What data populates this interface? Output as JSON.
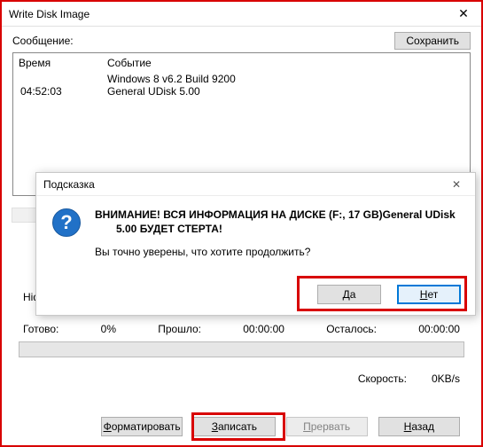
{
  "window": {
    "title": "Write Disk Image",
    "close_glyph": "✕"
  },
  "message": {
    "label": "Сообщение:",
    "save_label": "Сохранить"
  },
  "log": {
    "col_time": "Время",
    "col_event": "Событие",
    "rows": [
      {
        "time": "",
        "event": "Windows 8 v6.2 Build 9200"
      },
      {
        "time": "04:52:03",
        "event": "General UDisk        5.00"
      }
    ]
  },
  "hidden_label_prefix": "Hid",
  "progress": {
    "ready_label": "Готово:",
    "percent": "0%",
    "elapsed_label": "Прошло:",
    "elapsed": "00:00:00",
    "remain_label": "Осталось:",
    "remain": "00:00:00"
  },
  "speed": {
    "label": "Скорость:",
    "value": "0KB/s"
  },
  "buttons": {
    "format": "Форматировать",
    "write": "Записать",
    "abort": "Прервать",
    "back": "Назад",
    "format_u": "Ф",
    "write_u": "З",
    "abort_u": "П",
    "back_u": "Н"
  },
  "dialog": {
    "title": "Подсказка",
    "close_glyph": "✕",
    "line1": "ВНИМАНИЕ! ВСЯ ИНФОРМАЦИЯ НА ДИСКЕ (F:, 17 GB)General UDisk",
    "line1b": "5.00 БУДЕТ СТЕРТА!",
    "line2": "Вы точно уверены, что хотите продолжить?",
    "yes": "Да",
    "no": "Нет",
    "yes_u": "Д",
    "no_u": "Н"
  }
}
